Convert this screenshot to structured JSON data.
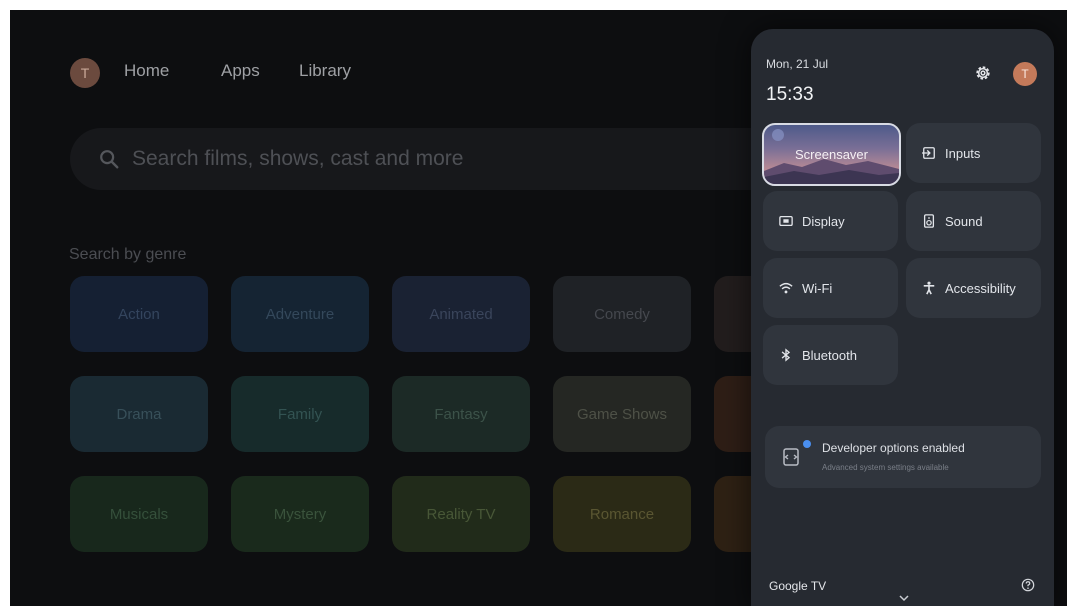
{
  "header": {
    "avatar_initial": "T",
    "nav": [
      "Home",
      "Apps",
      "Library"
    ]
  },
  "search": {
    "placeholder": "Search films, shows, cast and more"
  },
  "genres": {
    "title": "Search by genre",
    "items": [
      "Action",
      "Adventure",
      "Animated",
      "Comedy",
      "Drama",
      "Family",
      "Fantasy",
      "Game Shows",
      "Musicals",
      "Mystery",
      "Reality TV",
      "Romance"
    ]
  },
  "panel": {
    "date": "Mon, 21 Jul",
    "time": "15:33",
    "avatar_initial": "T",
    "tiles": {
      "screensaver": "Screensaver",
      "inputs": "Inputs",
      "display": "Display",
      "sound": "Sound",
      "wifi": "Wi-Fi",
      "accessibility": "Accessibility",
      "bluetooth": "Bluetooth"
    },
    "developer": {
      "title": "Developer options enabled",
      "subtitle": "Advanced system settings available"
    },
    "footer_brand": "Google TV"
  },
  "colors": {
    "panel_bg": "#262a31",
    "tile_bg": "#30353d",
    "accent_dot": "#4a8ff0",
    "avatar": "#c47a5a"
  }
}
